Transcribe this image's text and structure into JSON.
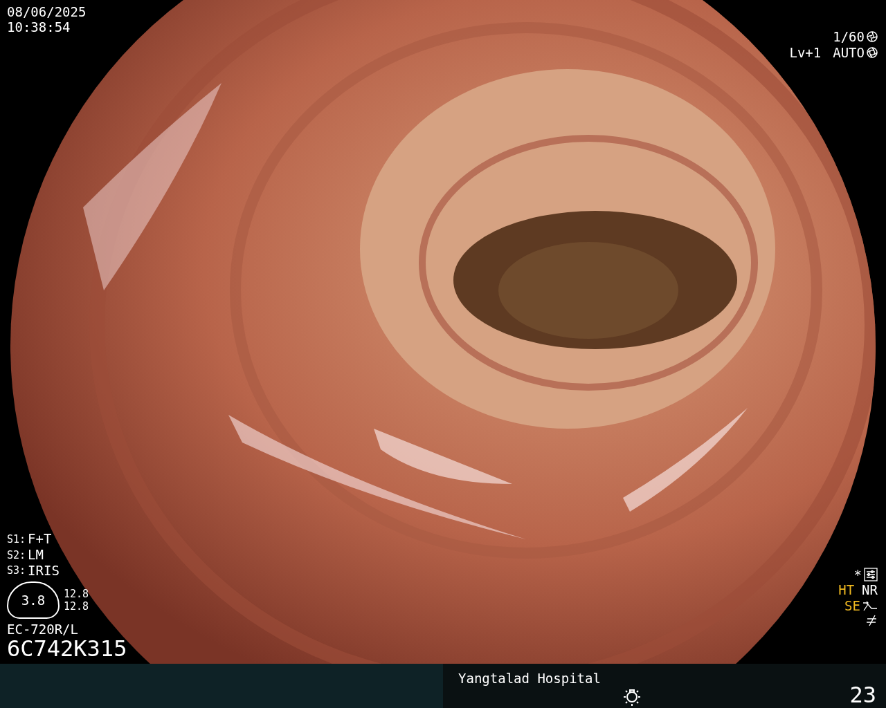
{
  "timestamp": {
    "date": "08/06/2025",
    "time": "10:38:54"
  },
  "exposure": {
    "shutter": "1/60",
    "level": "Lv+1",
    "mode": "AUTO"
  },
  "scope_settings": [
    {
      "key": "S1:",
      "value": "F+T"
    },
    {
      "key": "S2:",
      "value": "LM"
    },
    {
      "key": "S3:",
      "value": "IRIS"
    }
  ],
  "gauge": {
    "value": "3.8",
    "readings": [
      "12.8",
      "12.8"
    ]
  },
  "scope": {
    "model": "EC-720R/L",
    "serial": "6C742K315"
  },
  "indicators": [
    {
      "kind": "sliders",
      "labels": [
        {
          "text": "*",
          "color": "#ffffff"
        }
      ]
    },
    {
      "kind": "plain",
      "labels": [
        {
          "text": "HT",
          "color": "#f0b820"
        },
        {
          "text": "NR",
          "color": "#ffffff"
        }
      ]
    },
    {
      "kind": "edge",
      "labels": [
        {
          "text": "SE",
          "color": "#f0b820"
        }
      ]
    },
    {
      "kind": "notequal"
    }
  ],
  "footer": {
    "hospital": "Yangtalad Hospital",
    "counter": "23"
  }
}
